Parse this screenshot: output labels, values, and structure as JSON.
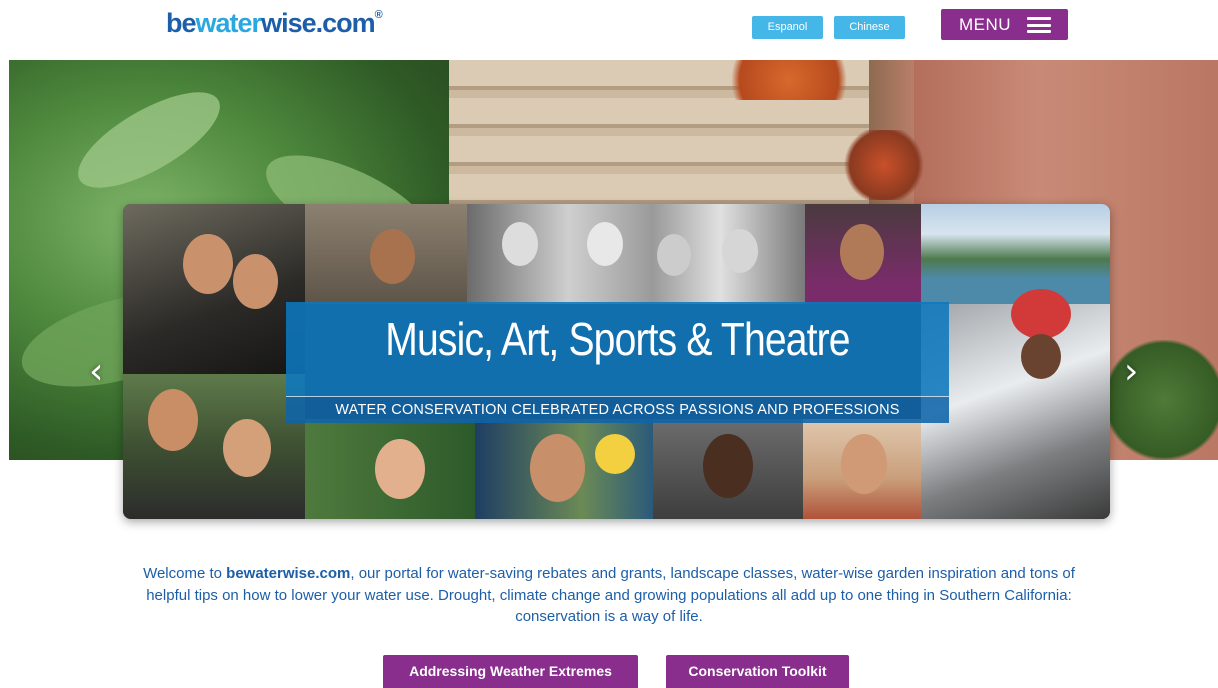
{
  "header": {
    "logo_part1": "be",
    "logo_part2": "water",
    "logo_part3": "wise.com",
    "logo_mark": "®",
    "lang_buttons": [
      "Espanol",
      "Chinese"
    ],
    "menu_label": "MENU",
    "menu_icon": "hamburger-icon"
  },
  "carousel": {
    "prev_icon": "‹",
    "next_icon": "›",
    "title": "Music, Art, Sports & Theatre",
    "subtitle": "WATER CONSERVATION CELEBRATED ACROSS PASSIONS AND PROFESSIONS"
  },
  "intro": {
    "lead": "Welcome to ",
    "site": "bewaterwise.com",
    "body": ", our portal for water-saving rebates and grants, landscape classes, water-wise garden inspiration and tons of helpful tips on how to lower your water use. Drought, climate change and growing populations all add up to one thing in Southern California: conservation is a way of life."
  },
  "cta": {
    "weather": "Addressing Weather Extremes",
    "toolkit": "Conservation Toolkit"
  },
  "colors": {
    "brand_blue": "#1d5ea8",
    "accent_cyan": "#45b6e8",
    "purple": "#8a2e8e"
  }
}
